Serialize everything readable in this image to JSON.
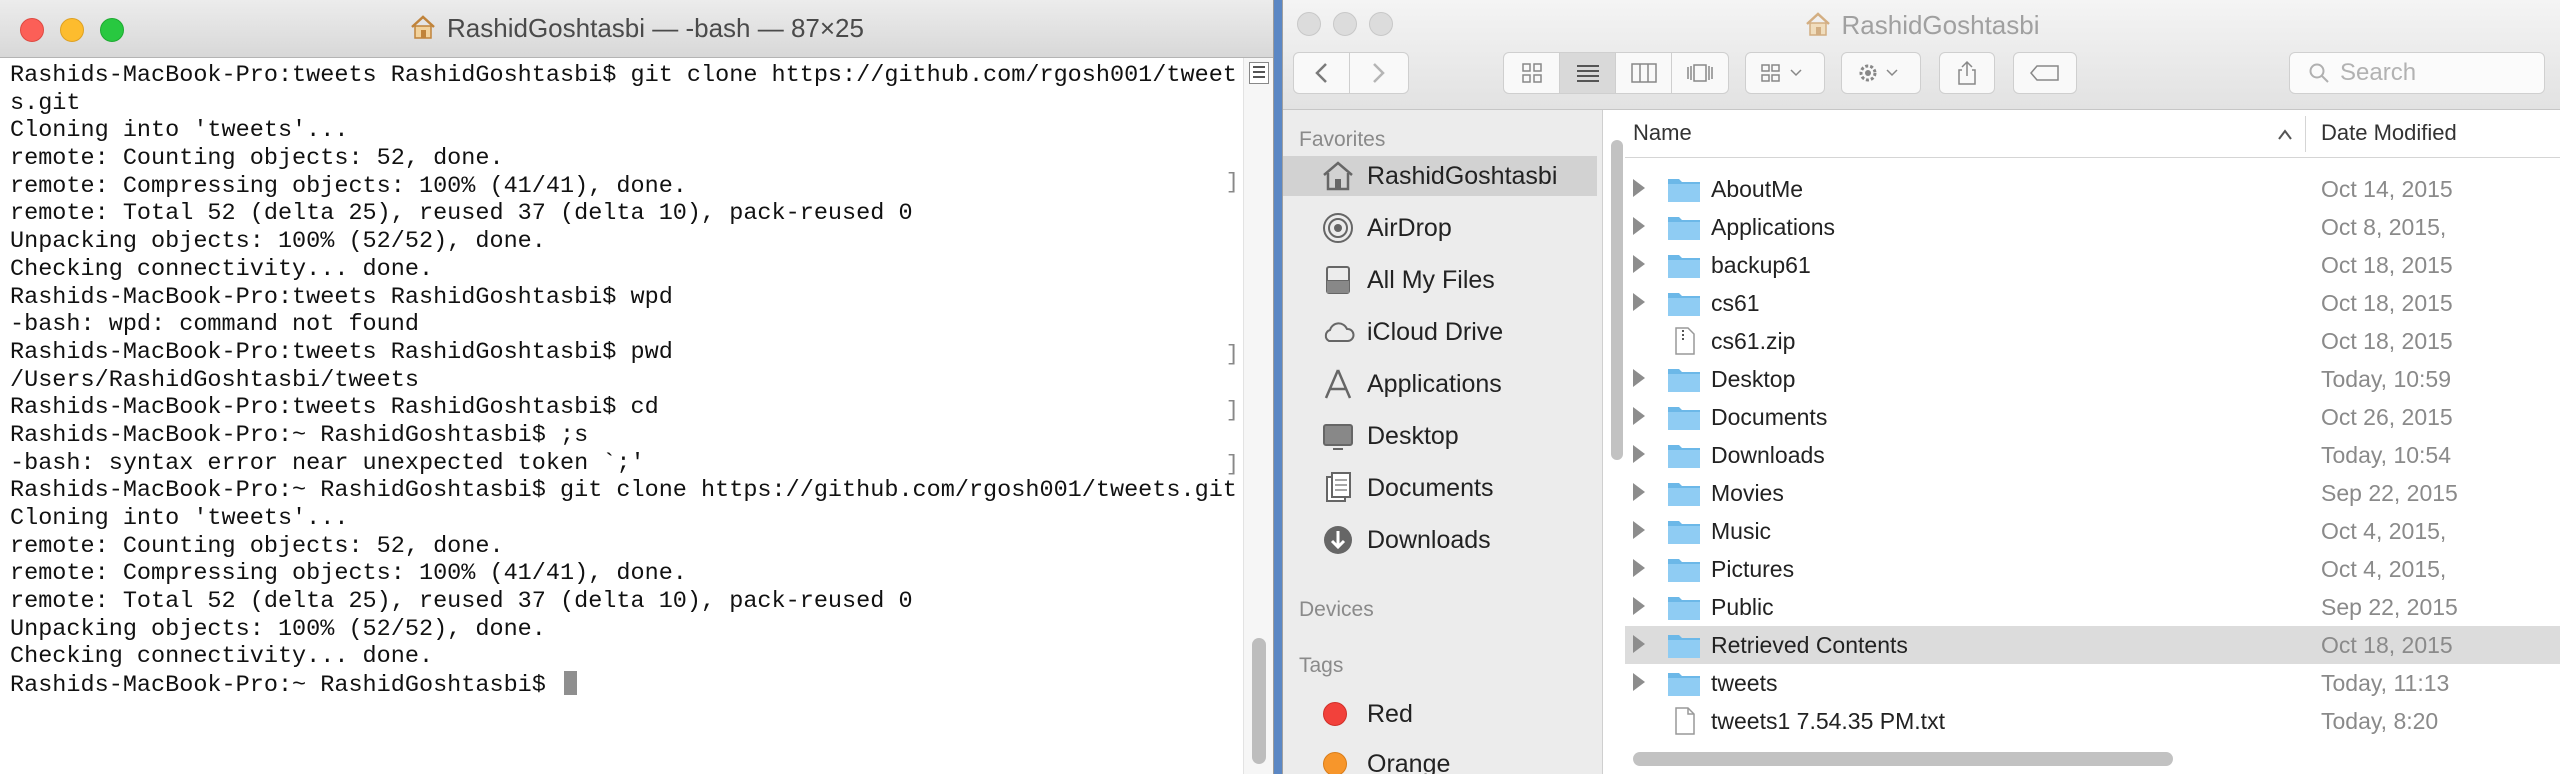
{
  "terminal": {
    "title": "RashidGoshtasbi — -bash — 87×25",
    "lines": [
      "Rashids-MacBook-Pro:tweets RashidGoshtasbi$ git clone https://github.com/rgosh001/tweet",
      "s.git",
      "Cloning into 'tweets'...",
      "remote: Counting objects: 52, done.",
      "remote: Compressing objects: 100% (41/41), done.",
      "remote: Total 52 (delta 25), reused 37 (delta 10), pack-reused 0",
      "Unpacking objects: 100% (52/52), done.",
      "Checking connectivity... done.",
      "Rashids-MacBook-Pro:tweets RashidGoshtasbi$ wpd",
      "-bash: wpd: command not found",
      "Rashids-MacBook-Pro:tweets RashidGoshtasbi$ pwd",
      "/Users/RashidGoshtasbi/tweets",
      "Rashids-MacBook-Pro:tweets RashidGoshtasbi$ cd",
      "Rashids-MacBook-Pro:~ RashidGoshtasbi$ ;s",
      "-bash: syntax error near unexpected token `;'",
      "Rashids-MacBook-Pro:~ RashidGoshtasbi$ git clone https://github.com/rgosh001/tweets.git",
      "Cloning into 'tweets'...",
      "remote: Counting objects: 52, done.",
      "remote: Compressing objects: 100% (41/41), done.",
      "remote: Total 52 (delta 25), reused 37 (delta 10), pack-reused 0",
      "Unpacking objects: 100% (52/52), done.",
      "Checking connectivity... done.",
      "Rashids-MacBook-Pro:~ RashidGoshtasbi$ "
    ],
    "bracket_mark": "]"
  },
  "finder": {
    "title": "RashidGoshtasbi",
    "search_placeholder": "Search",
    "sidebar": {
      "favorites_heading": "Favorites",
      "favorites": [
        {
          "label": "RashidGoshtasbi",
          "icon": "home-icon",
          "selected": true
        },
        {
          "label": "AirDrop",
          "icon": "airdrop-icon"
        },
        {
          "label": "All My Files",
          "icon": "all-files-icon"
        },
        {
          "label": "iCloud Drive",
          "icon": "cloud-icon"
        },
        {
          "label": "Applications",
          "icon": "applications-icon"
        },
        {
          "label": "Desktop",
          "icon": "desktop-icon"
        },
        {
          "label": "Documents",
          "icon": "documents-icon"
        },
        {
          "label": "Downloads",
          "icon": "downloads-icon"
        }
      ],
      "devices_heading": "Devices",
      "tags_heading": "Tags",
      "tags": [
        {
          "label": "Red",
          "color": "#f2413b"
        },
        {
          "label": "Orange",
          "color": "#f7962b"
        }
      ]
    },
    "columns": {
      "name": "Name",
      "date": "Date Modified"
    },
    "files": [
      {
        "name": "AboutMe",
        "date": "Oct 14, 2015",
        "kind": "folder"
      },
      {
        "name": "Applications",
        "date": "Oct 8, 2015,",
        "kind": "folder"
      },
      {
        "name": "backup61",
        "date": "Oct 18, 2015",
        "kind": "folder"
      },
      {
        "name": "cs61",
        "date": "Oct 18, 2015",
        "kind": "folder"
      },
      {
        "name": "cs61.zip",
        "date": "Oct 18, 2015",
        "kind": "zip"
      },
      {
        "name": "Desktop",
        "date": "Today, 10:59",
        "kind": "folder"
      },
      {
        "name": "Documents",
        "date": "Oct 26, 2015",
        "kind": "folder"
      },
      {
        "name": "Downloads",
        "date": "Today, 10:54",
        "kind": "folder"
      },
      {
        "name": "Movies",
        "date": "Sep 22, 2015",
        "kind": "folder"
      },
      {
        "name": "Music",
        "date": "Oct 4, 2015,",
        "kind": "folder"
      },
      {
        "name": "Pictures",
        "date": "Oct 4, 2015,",
        "kind": "folder"
      },
      {
        "name": "Public",
        "date": "Sep 22, 2015",
        "kind": "folder"
      },
      {
        "name": "Retrieved Contents",
        "date": "Oct 18, 2015",
        "kind": "folder",
        "selected": true
      },
      {
        "name": "tweets",
        "date": "Today, 11:13",
        "kind": "folder"
      },
      {
        "name": "tweets1 7.54.35 PM.txt",
        "date": "Today, 8:20",
        "kind": "file"
      }
    ]
  }
}
